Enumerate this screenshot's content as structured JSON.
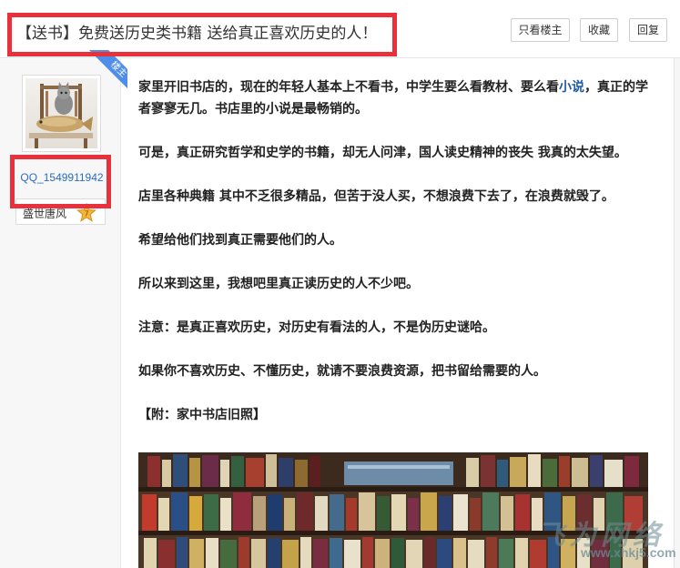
{
  "thread": {
    "title": "【送书】免费送历史类书籍 送给真正喜欢历史的人！"
  },
  "header_buttons": {
    "author_only": "只看楼主",
    "favorite": "收藏",
    "reply": "回复"
  },
  "author": {
    "badge": "楼主",
    "username": "QQ_1549911942",
    "rank": "盛世唐风"
  },
  "post": {
    "p1_before": "家里开旧书店的，现在的年轻人基本上不看书，中学生要么看教材、要么看",
    "p1_link": "小说",
    "p1_after": "，真正的学者寥寥无几。书店里的小说是最畅销的。",
    "p2": "可是，真正研究哲学和史学的书籍，却无人问津，国人读史精神的丧失 我真的太失望。",
    "p3": "店里各种典籍 其中不乏很多精品，但苦于没人买，不想浪费下去了，在浪费就毁了。",
    "p4": "希望给他们找到真正需要他们的人。",
    "p5": "所以来到这里，我想吧里真正读历史的人不少吧。",
    "p6": "注意：是真正喜欢历史，对历史有看法的人，不是伪历史谜哈。",
    "p7": "如果你不喜欢历史、不懂历史，就请不要浪费资源，把书留给需要的人。",
    "attachment_label": "【附：家中书店旧照】"
  },
  "watermark": {
    "text": "飞为网络",
    "url": "www.xhkj5.com"
  },
  "colors": {
    "highlight_box": "#e8313a",
    "link": "#1e5aa8",
    "username": "#2a6cc2",
    "badge": "#4f8ee8"
  },
  "icons": {
    "rank_badge": "star-badge-icon",
    "avatar": "cat-with-fish-avatar"
  }
}
